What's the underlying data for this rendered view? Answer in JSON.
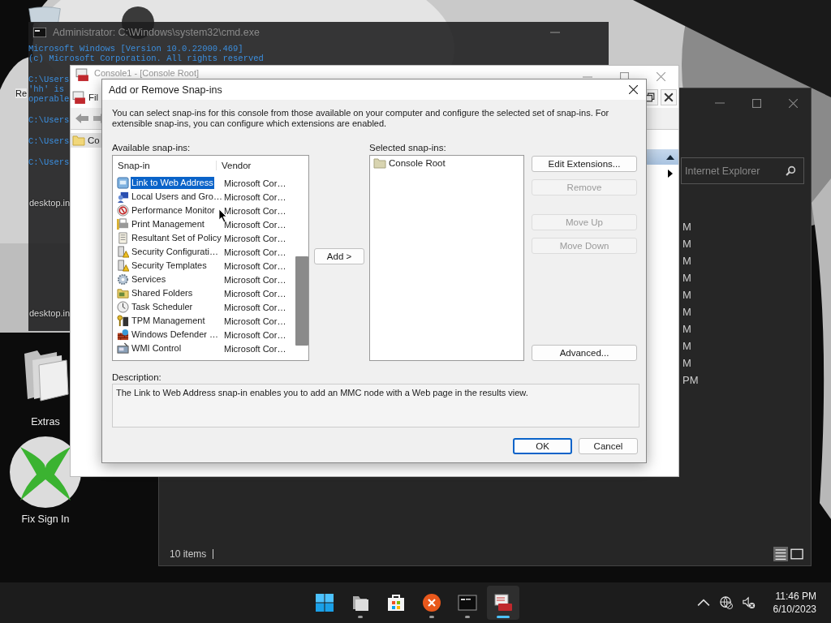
{
  "desktop": {
    "icons": [
      {
        "label": "Extras",
        "kind": "folder"
      },
      {
        "label": "Fix Sign In",
        "kind": "xbox"
      }
    ],
    "covered_labels": [
      "Re",
      "desktop.in",
      "desktop.in"
    ]
  },
  "cmd_window": {
    "title": "Administrator: C:\\Windows\\system32\\cmd.exe",
    "blocks": [
      [
        "Microsoft Windows [Version 10.0.22000.469]",
        "(c) Microsoft Corporation. All rights reserved"
      ],
      [
        "C:\\Users",
        "'hh' is",
        "operable"
      ],
      [
        "C:\\Users"
      ],
      [
        "C:\\Users"
      ],
      [
        "C:\\Users"
      ]
    ]
  },
  "explorer_window": {
    "search": {
      "placeholder": "Internet Explorer"
    },
    "times": [
      "M",
      "M",
      "M",
      "M",
      "M",
      "M",
      "M",
      "M",
      "M",
      "PM"
    ],
    "status": "10 items"
  },
  "mmc_window": {
    "title": "Console1 - [Console Root]",
    "menu": [
      "Fil"
    ],
    "tree": [
      "Co"
    ]
  },
  "dialog": {
    "title": "Add or Remove Snap-ins",
    "intro": "You can select snap-ins for this console from those available on your computer and configure the selected set of snap-ins. For extensible snap-ins, you can configure which extensions are enabled.",
    "available_label": "Available snap-ins:",
    "columns": [
      "Snap-in",
      "Vendor"
    ],
    "snapins": [
      {
        "name": "Link to Web Address",
        "vendor": "Microsoft Cor…",
        "kind": "web",
        "selected": true
      },
      {
        "name": "Local Users and Gro…",
        "vendor": "Microsoft Cor…",
        "kind": "users",
        "selected": false
      },
      {
        "name": "Performance Monitor",
        "vendor": "Microsoft Cor…",
        "kind": "gauge",
        "selected": false
      },
      {
        "name": "Print Management",
        "vendor": "Microsoft Cor…",
        "kind": "printer",
        "selected": false
      },
      {
        "name": "Resultant Set of Policy",
        "vendor": "Microsoft Cor…",
        "kind": "document",
        "selected": false
      },
      {
        "name": "Security Configurati…",
        "vendor": "Microsoft Cor…",
        "kind": "warning",
        "selected": false
      },
      {
        "name": "Security Templates",
        "vendor": "Microsoft Cor…",
        "kind": "warning",
        "selected": false
      },
      {
        "name": "Services",
        "vendor": "Microsoft Cor…",
        "kind": "gear",
        "selected": false
      },
      {
        "name": "Shared Folders",
        "vendor": "Microsoft Cor…",
        "kind": "folder",
        "selected": false
      },
      {
        "name": "Task Scheduler",
        "vendor": "Microsoft Cor…",
        "kind": "clock",
        "selected": false
      },
      {
        "name": "TPM Management",
        "vendor": "Microsoft Cor…",
        "kind": "key",
        "selected": false
      },
      {
        "name": "Windows Defender …",
        "vendor": "Microsoft Cor…",
        "kind": "wall",
        "selected": false
      },
      {
        "name": "WMI Control",
        "vendor": "Microsoft Cor…",
        "kind": "computer",
        "selected": false
      }
    ],
    "add_button": "Add >",
    "selected_label": "Selected snap-ins:",
    "selected_items": [
      {
        "name": "Console Root"
      }
    ],
    "side_button_groups": [
      [
        {
          "label": "Edit Extensions...",
          "disabled": false
        },
        {
          "label": "Remove",
          "disabled": true
        }
      ],
      [
        {
          "label": "Move Up",
          "disabled": true
        },
        {
          "label": "Move Down",
          "disabled": true
        }
      ],
      [
        {
          "label": "Advanced...",
          "disabled": false
        }
      ]
    ],
    "description_label": "Description:",
    "description": "The Link to Web Address snap-in enables you to add an MMC node with a Web page in the results view.",
    "buttons": [
      {
        "label": "OK",
        "default": true
      },
      {
        "label": "Cancel",
        "default": false
      }
    ]
  },
  "taskbar": {
    "apps": [
      {
        "kind": "start",
        "running": false,
        "selected": false
      },
      {
        "kind": "files",
        "running": true,
        "selected": false
      },
      {
        "kind": "store",
        "running": false,
        "selected": false
      },
      {
        "kind": "close-app",
        "running": true,
        "selected": false
      },
      {
        "kind": "terminal",
        "running": true,
        "selected": false
      },
      {
        "kind": "toolbox",
        "running": true,
        "selected": true
      }
    ],
    "time": "11:46 PM",
    "date": "6/10/2023"
  }
}
